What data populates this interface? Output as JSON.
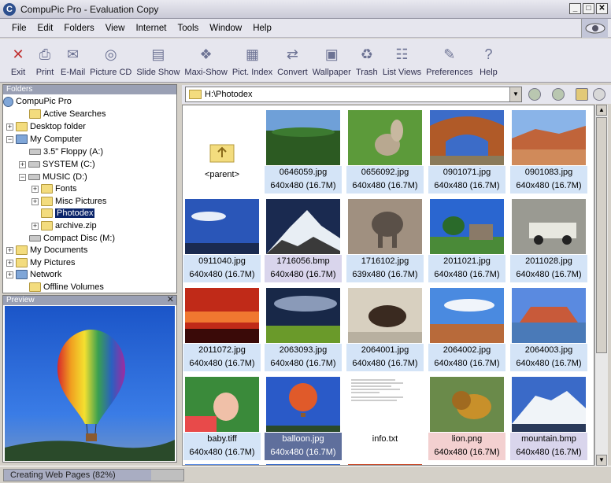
{
  "window": {
    "title": "CompuPic Pro - Evaluation Copy"
  },
  "menu": [
    "File",
    "Edit",
    "Folders",
    "View",
    "Internet",
    "Tools",
    "Window",
    "Help"
  ],
  "toolbar": [
    {
      "label": "Exit",
      "icon": "exit-icon",
      "glyph": "✕"
    },
    {
      "label": "Print",
      "icon": "print-icon",
      "glyph": "⎙"
    },
    {
      "label": "E-Mail",
      "icon": "email-icon",
      "glyph": "✉"
    },
    {
      "label": "Picture CD",
      "icon": "picture-cd-icon",
      "glyph": "◎"
    },
    {
      "label": "Slide Show",
      "icon": "slide-show-icon",
      "glyph": "▤"
    },
    {
      "label": "Maxi-Show",
      "icon": "maxi-show-icon",
      "glyph": "❖"
    },
    {
      "label": "Pict. Index",
      "icon": "pict-index-icon",
      "glyph": "▦"
    },
    {
      "label": "Convert",
      "icon": "convert-icon",
      "glyph": "⇄"
    },
    {
      "label": "Wallpaper",
      "icon": "wallpaper-icon",
      "glyph": "▣"
    },
    {
      "label": "Trash",
      "icon": "trash-icon",
      "glyph": "♻"
    },
    {
      "label": "List Views",
      "icon": "list-views-icon",
      "glyph": "☷"
    },
    {
      "label": "Preferences",
      "icon": "preferences-icon",
      "glyph": "✎"
    },
    {
      "label": "Help",
      "icon": "help-icon",
      "glyph": "?"
    }
  ],
  "folders_panel": {
    "title": "Folders"
  },
  "tree": [
    {
      "label": "CompuPic Pro",
      "icon": "compupic-icon",
      "indent": 0,
      "pm": ""
    },
    {
      "label": "Active Searches",
      "icon": "search-folder-icon",
      "indent": 1,
      "pm": ""
    },
    {
      "label": "Desktop folder",
      "icon": "folder-icon",
      "indent": 1,
      "pm": "+"
    },
    {
      "label": "My Computer",
      "icon": "computer-icon",
      "indent": 1,
      "pm": "−"
    },
    {
      "label": "3.5\" Floppy (A:)",
      "icon": "floppy-icon",
      "indent": 2,
      "pm": ""
    },
    {
      "label": "SYSTEM (C:)",
      "icon": "drive-icon",
      "indent": 2,
      "pm": "+"
    },
    {
      "label": "MUSIC (D:)",
      "icon": "drive-icon",
      "indent": 2,
      "pm": "−"
    },
    {
      "label": "Fonts",
      "icon": "folder-icon",
      "indent": 3,
      "pm": "+"
    },
    {
      "label": "Misc Pictures",
      "icon": "folder-icon",
      "indent": 3,
      "pm": "+"
    },
    {
      "label": "Photodex",
      "icon": "folder-open-icon",
      "indent": 3,
      "pm": "",
      "selected": true
    },
    {
      "label": "archive.zip",
      "icon": "zip-icon",
      "indent": 3,
      "pm": "+"
    },
    {
      "label": "Compact Disc (M:)",
      "icon": "cdrom-icon",
      "indent": 2,
      "pm": ""
    },
    {
      "label": "My Documents",
      "icon": "folder-icon",
      "indent": 0,
      "pm": "+"
    },
    {
      "label": "My Pictures",
      "icon": "folder-icon",
      "indent": 0,
      "pm": "+"
    },
    {
      "label": "Network",
      "icon": "network-icon",
      "indent": 0,
      "pm": "+"
    },
    {
      "label": "Offline Volumes",
      "icon": "folder-icon",
      "indent": 1,
      "pm": ""
    }
  ],
  "preview_panel": {
    "title": "Preview"
  },
  "path": {
    "value": "H:\\Photodex"
  },
  "thumbnails": [
    {
      "name": "<parent>",
      "size": "",
      "kind": "parent",
      "style": "plain"
    },
    {
      "name": "0646059.jpg",
      "size": "640x480 (16.7M)",
      "kind": "forest",
      "style": "blue"
    },
    {
      "name": "0656092.jpg",
      "size": "640x480 (16.7M)",
      "kind": "squirrel",
      "style": "blue"
    },
    {
      "name": "0901071.jpg",
      "size": "640x480 (16.7M)",
      "kind": "arch",
      "style": "blue"
    },
    {
      "name": "0901083.jpg",
      "size": "640x480 (16.7M)",
      "kind": "canyon",
      "style": "blue"
    },
    {
      "name": "0911040.jpg",
      "size": "640x480 (16.7M)",
      "kind": "sky",
      "style": "blue"
    },
    {
      "name": "1716056.bmp",
      "size": "640x480 (16.7M)",
      "kind": "peak",
      "style": "purple"
    },
    {
      "name": "1716102.jpg",
      "size": "639x480 (16.7M)",
      "kind": "elephant",
      "style": "blue"
    },
    {
      "name": "2011021.jpg",
      "size": "640x480 (16.7M)",
      "kind": "cabin",
      "style": "blue"
    },
    {
      "name": "2011028.jpg",
      "size": "640x480 (16.7M)",
      "kind": "truck",
      "style": "blue"
    },
    {
      "name": "2011072.jpg",
      "size": "640x480 (16.7M)",
      "kind": "sunset",
      "style": "blue"
    },
    {
      "name": "2063093.jpg",
      "size": "640x480 (16.7M)",
      "kind": "storm",
      "style": "blue"
    },
    {
      "name": "2064001.jpg",
      "size": "640x480 (16.7M)",
      "kind": "bison",
      "style": "blue"
    },
    {
      "name": "2064002.jpg",
      "size": "640x480 (16.7M)",
      "kind": "desert",
      "style": "blue"
    },
    {
      "name": "2064003.jpg",
      "size": "640x480 (16.7M)",
      "kind": "mesa",
      "style": "blue"
    },
    {
      "name": "baby.tiff",
      "size": "640x480 (16.7M)",
      "kind": "baby",
      "style": "blue"
    },
    {
      "name": "balloon.jpg",
      "size": "640x480 (16.7M)",
      "kind": "balloon",
      "style": "selected"
    },
    {
      "name": "info.txt",
      "size": "",
      "kind": "text",
      "style": "plain"
    },
    {
      "name": "lion.png",
      "size": "640x480 (16.7M)",
      "kind": "lion",
      "style": "pink"
    },
    {
      "name": "mountain.bmp",
      "size": "640x480 (16.7M)",
      "kind": "mountain",
      "style": "purple"
    }
  ],
  "status": {
    "text": "Creating Web Pages (82%)",
    "progress": 0.82
  }
}
